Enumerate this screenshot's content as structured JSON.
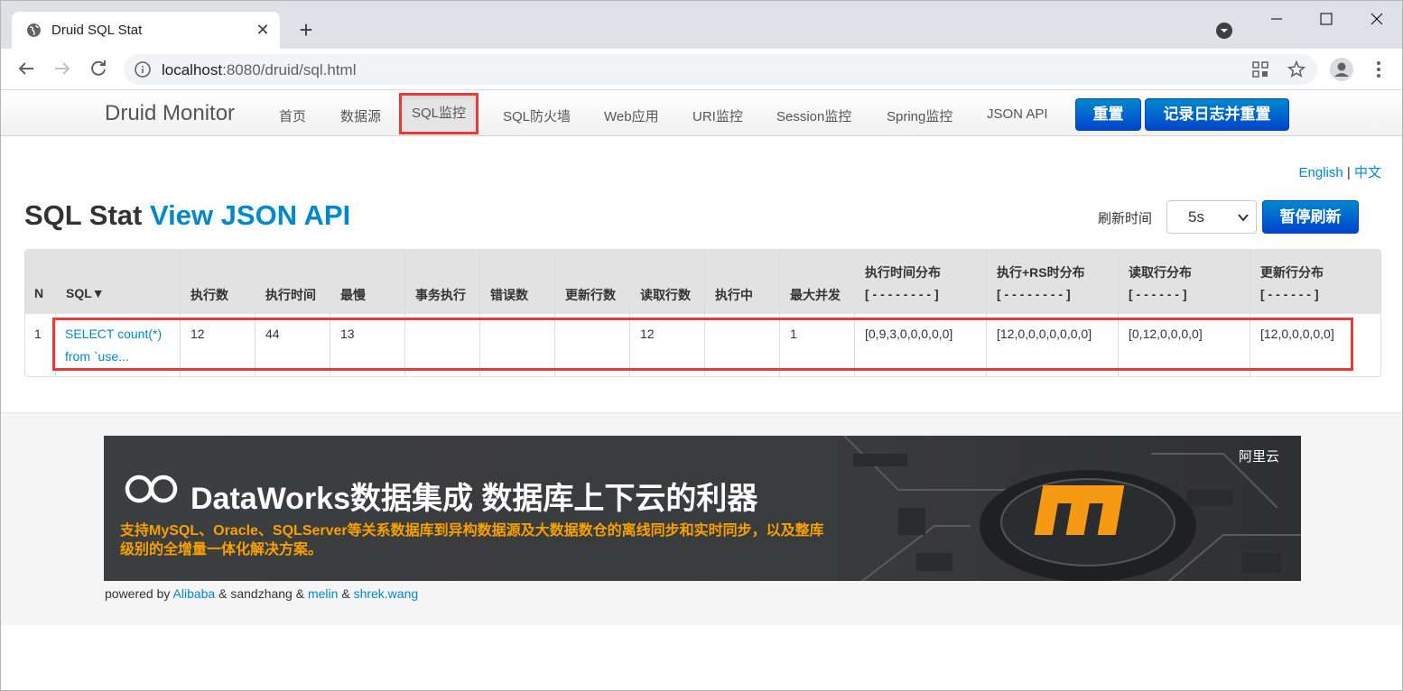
{
  "browser": {
    "tab_title": "Druid SQL Stat",
    "new_tab": "+",
    "close": "✕",
    "url_host": "localhost",
    "url_path": ":8080/druid/sql.html"
  },
  "navbar": {
    "brand": "Druid Monitor",
    "items": [
      "首页",
      "数据源",
      "SQL监控",
      "SQL防火墙",
      "Web应用",
      "URI监控",
      "Session监控",
      "Spring监控",
      "JSON API"
    ],
    "reset": "重置",
    "log_reset": "记录日志并重置"
  },
  "lang": {
    "english": "English",
    "sep": "|",
    "chinese": "中文"
  },
  "heading": {
    "title": "SQL Stat",
    "api_link": "View JSON API"
  },
  "refresh": {
    "label": "刷新时间",
    "value": "5s",
    "pause": "暂停刷新"
  },
  "table": {
    "headers": [
      "N",
      "SQL▼",
      "执行数",
      "执行时间",
      "最慢",
      "事务执行",
      "错误数",
      "更新行数",
      "读取行数",
      "执行中",
      "最大并发",
      "执行时间分布",
      "执行+RS时分布",
      "读取行分布",
      "更新行分布"
    ],
    "header_sub": [
      "[ - - - - - - - - ]",
      "[ - - - - - - - - ]",
      "[ - - - - - - ]",
      "[ - - - - - - ]"
    ],
    "row": [
      "1",
      "SELECT count(*) from `use...",
      "12",
      "44",
      "13",
      "",
      "",
      "",
      "12",
      "",
      "1",
      "[0,9,3,0,0,0,0,0]",
      "[12,0,0,0,0,0,0,0]",
      "[0,12,0,0,0,0]",
      "[12,0,0,0,0,0]"
    ]
  },
  "banner": {
    "title": "DataWorks数据集成 数据库上下云的利器",
    "subtitle": "支持MySQL、Oracle、SQLServer等关系数据库到异构数据源及大数据数仓的离线同步和实时同步，以及整库级别的全增量一体化解决方案。",
    "logo": "阿里云"
  },
  "footer": {
    "prefix": "powered by",
    "alibaba": "Alibaba",
    "amp1": "& sandzhang &",
    "melin": "melin",
    "amp2": "&",
    "shrek": "shrek.wang"
  },
  "colors": {
    "accent": "#0088cc",
    "highlight": "#e53b3b",
    "banner_orange": "#f7a100"
  }
}
